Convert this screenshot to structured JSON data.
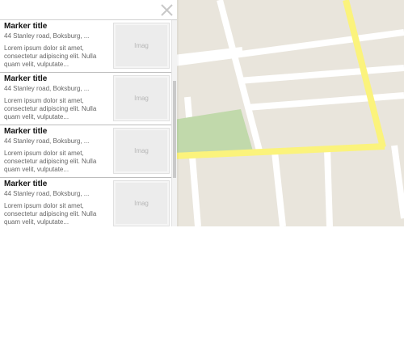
{
  "panel": {
    "close_icon": "close-icon",
    "items": [
      {
        "title": "Marker title",
        "address": "44 Stanley road, Boksburg, ...",
        "description": "Lorem ipsum dolor sit amet, consectetur adipiscing elit. Nulla quam velit, vulputate...",
        "image_label": "Imag"
      },
      {
        "title": "Marker title",
        "address": "44 Stanley road, Boksburg, ...",
        "description": "Lorem ipsum dolor sit amet, consectetur adipiscing elit. Nulla quam velit, vulputate...",
        "image_label": "Imag"
      },
      {
        "title": "Marker title",
        "address": "44 Stanley road, Boksburg, ...",
        "description": "Lorem ipsum dolor sit amet, consectetur adipiscing elit. Nulla quam velit, vulputate...",
        "image_label": "Imag"
      },
      {
        "title": "Marker title",
        "address": "44 Stanley road, Boksburg, ...",
        "description": "Lorem ipsum dolor sit amet, consectetur adipiscing elit. Nulla quam velit, vulputate...",
        "image_label": "Imag"
      }
    ]
  },
  "map": {
    "land_color": "#e9e5dc",
    "road_color": "#ffffff",
    "highway_color": "#fbf37c",
    "park_color": "#c1d9ab"
  }
}
